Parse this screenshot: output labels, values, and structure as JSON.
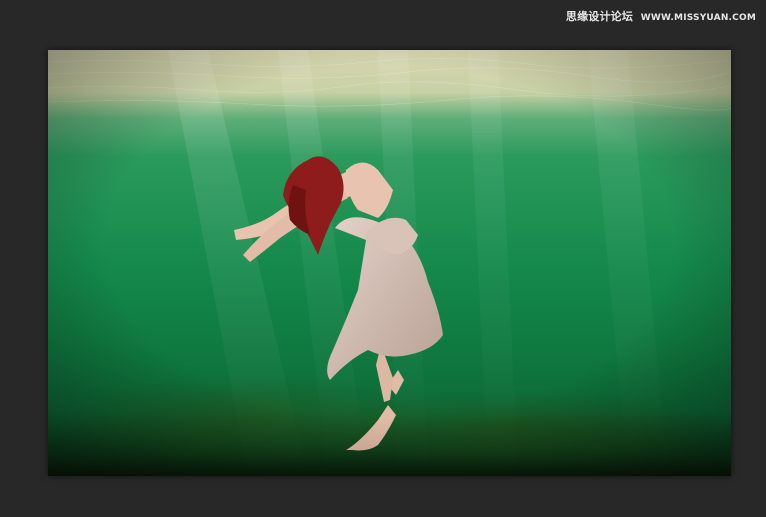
{
  "watermark": {
    "site_name_cn": "思缘设计论坛",
    "site_url": "WWW.MISSYUAN.COM"
  },
  "document": {
    "subject": "underwater-dancer-photo",
    "colors": {
      "surface_light": "#d8d7b0",
      "water_light": "#3a9a5e",
      "water_mid": "#158a4c",
      "water_deep": "#0d6a37",
      "floor_dark": "#0a1a08",
      "canvas_bg": "#282828",
      "dress": "#d9c2b8",
      "hair": "#8e1c1c",
      "skin": "#e7c3b0"
    }
  }
}
